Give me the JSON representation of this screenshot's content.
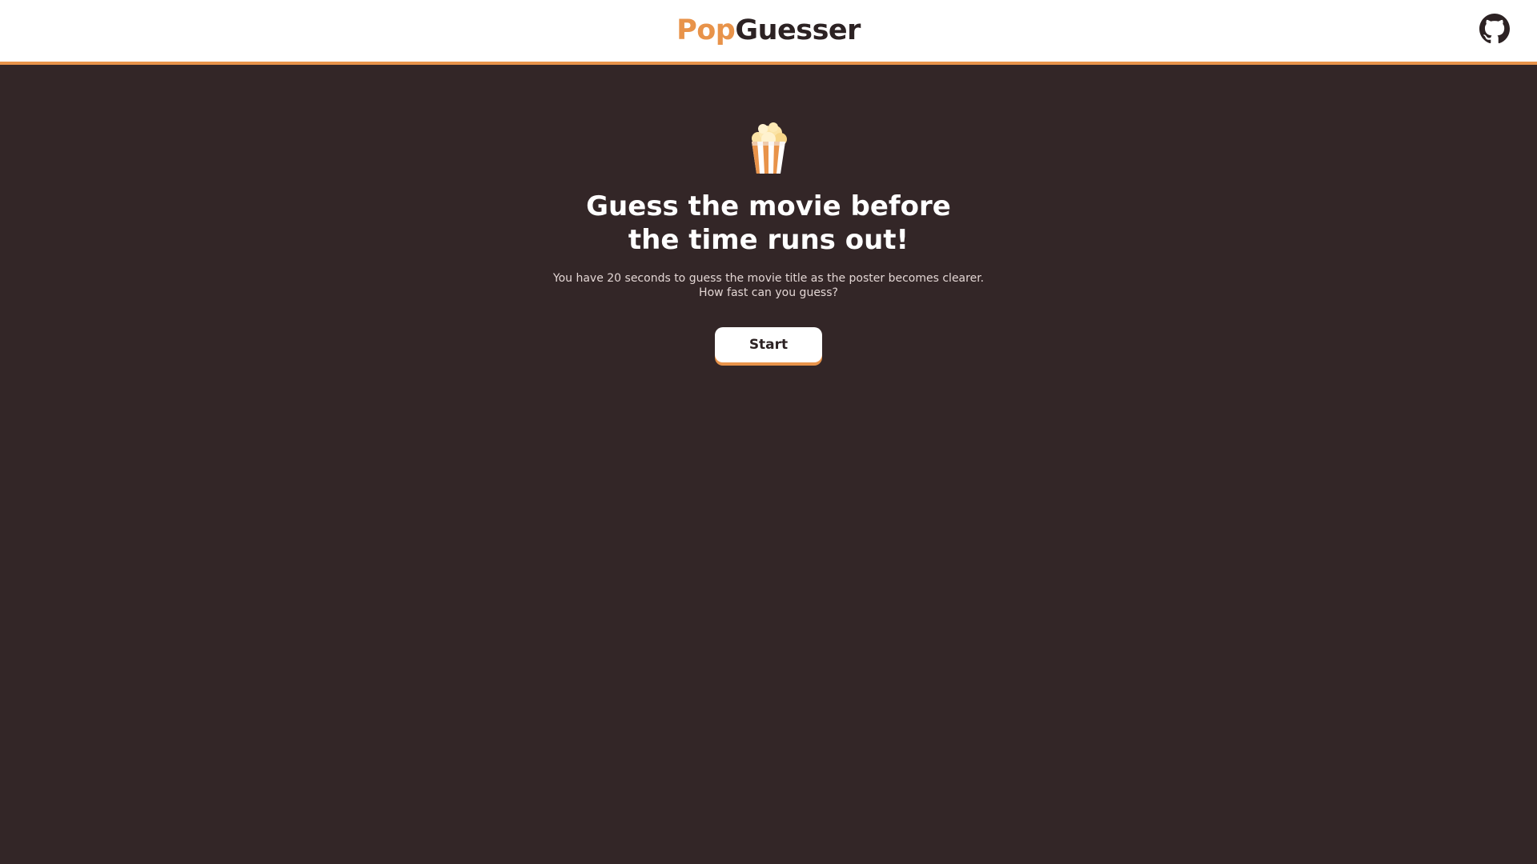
{
  "header": {
    "brand_part1": "Pop",
    "brand_part2": "Guesser",
    "github_icon": "github-icon"
  },
  "hero": {
    "icon": "popcorn-icon",
    "headline_line1": "Guess the movie before",
    "headline_line2": "the time runs out!",
    "subtitle_line1": "You have 20 seconds to guess the movie title as the poster becomes clearer.",
    "subtitle_line2": "How fast can you guess?",
    "start_label": "Start"
  },
  "colors": {
    "accent": "#e8934a",
    "background": "#332627",
    "header_bg": "#ffffff",
    "text_dark": "#2c2223"
  }
}
